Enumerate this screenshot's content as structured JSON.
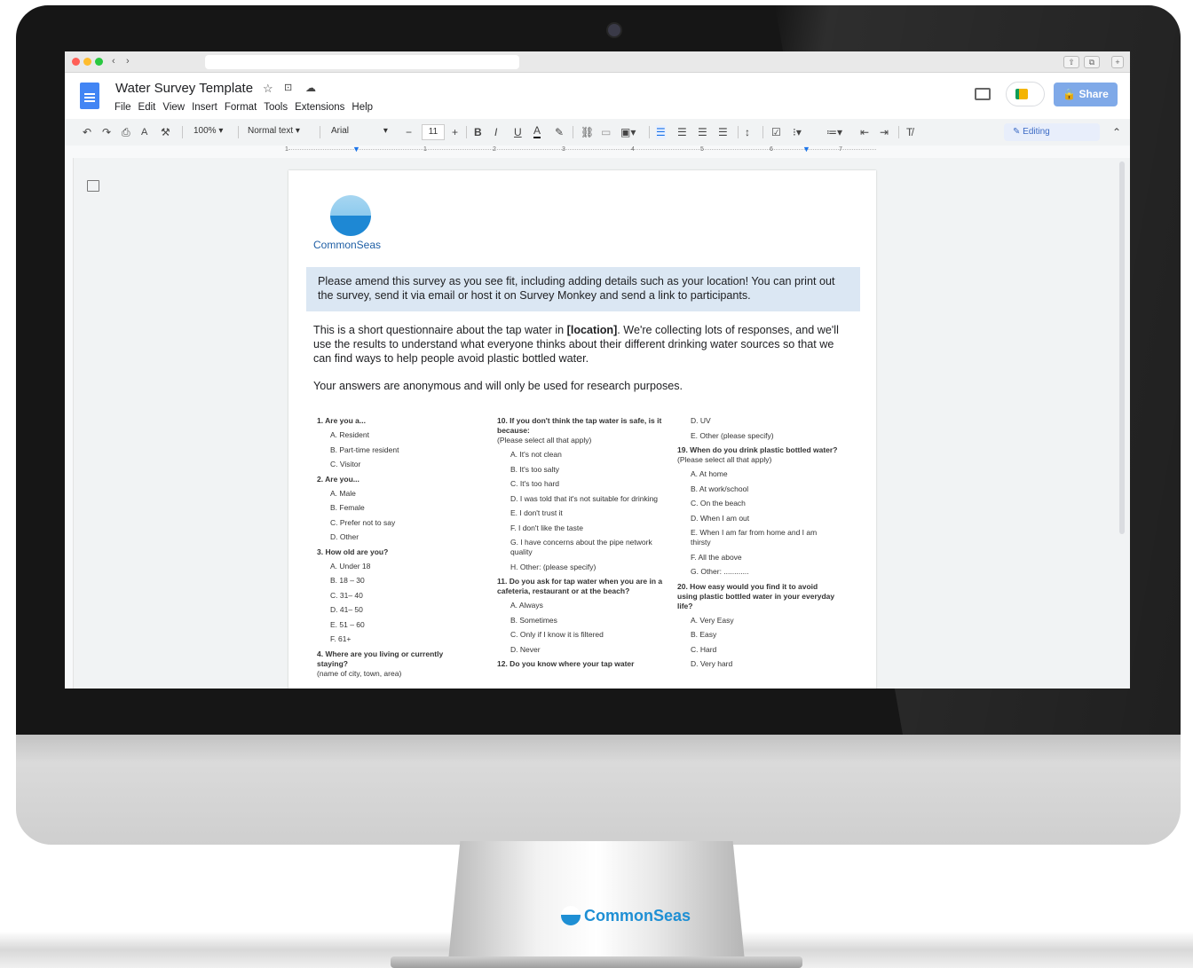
{
  "browser": {
    "back": "‹",
    "forward": "›"
  },
  "docs": {
    "title": "Water Survey Template",
    "menu": [
      "File",
      "Edit",
      "View",
      "Insert",
      "Format",
      "Tools",
      "Extensions",
      "Help"
    ],
    "share_label": "Share",
    "zoom": "100%",
    "style": "Normal text",
    "font": "Arial",
    "font_size": "11",
    "mode": "Editing",
    "ruler_marks": [
      "1",
      "1",
      "2",
      "3",
      "4",
      "5",
      "6",
      "7"
    ]
  },
  "page": {
    "logo_text": "CommonSeas",
    "banner": "Please amend this survey as you see fit, including adding details such as your location! You can print out the survey, send it via email or host it on Survey Monkey and send a link to participants.",
    "intro_a": "This is a short questionnaire about the tap water in ",
    "intro_bold": "[location]",
    "intro_b": ". We're collecting lots of responses, and we'll use the results to understand what everyone thinks about their different drinking water sources so that we can find ways to help people avoid plastic bottled water.",
    "anonymous": "Your answers are anonymous and will only be used for research purposes.",
    "col1": {
      "q1": "1. Are you a...",
      "q1_opts": [
        "A. Resident",
        "B. Part-time resident",
        "C. Visitor"
      ],
      "q2": "2. Are you...",
      "q2_opts": [
        "A. Male",
        "B. Female",
        "C. Prefer not to say",
        "D. Other"
      ],
      "q3": "3. How old are you?",
      "q3_opts": [
        "A. Under 18",
        "B. 18 – 30",
        "C. 31– 40",
        "D. 41– 50",
        "E. 51 – 60",
        "F. 61+"
      ],
      "q4": "4. Where are you living or currently staying?",
      "q4_sub": "(name of city, town, area)"
    },
    "col2": {
      "q10": "10. If you don't think the tap water is safe, is it because:",
      "q10_sub": "(Please select all that apply)",
      "q10_opts": [
        "A. It's not clean",
        "B. It's too salty",
        "C. It's too hard",
        "D. I was told that it's not suitable for drinking",
        "E. I don't trust it",
        "F. I don't like the taste",
        "G. I have concerns about the pipe network quality",
        "H. Other: (please specify)"
      ],
      "q11": "11. Do you ask for tap water when you are in a cafeteria, restaurant or at the beach?",
      "q11_opts": [
        "A. Always",
        "B. Sometimes",
        "C. Only if I know it is filtered",
        "D. Never"
      ],
      "q12": "12. Do you know where your tap water"
    },
    "col3": {
      "top_opts": [
        "D. UV",
        "E. Other (please specify)"
      ],
      "q19": "19. When do you drink plastic bottled water?",
      "q19_sub": "(Please select all that apply)",
      "q19_opts": [
        "A. At home",
        "B. At work/school",
        "C. On the beach",
        "D. When I am out",
        "E. When I am far from home and I am thirsty",
        "F. All the above",
        "G. Other: ............"
      ],
      "q20": "20. How easy would you find it to avoid using plastic bottled water in your everyday life?",
      "q20_opts": [
        "A. Very Easy",
        "B. Easy",
        "C. Hard",
        "D. Very hard"
      ]
    }
  },
  "stand_logo": "CommonSeas"
}
